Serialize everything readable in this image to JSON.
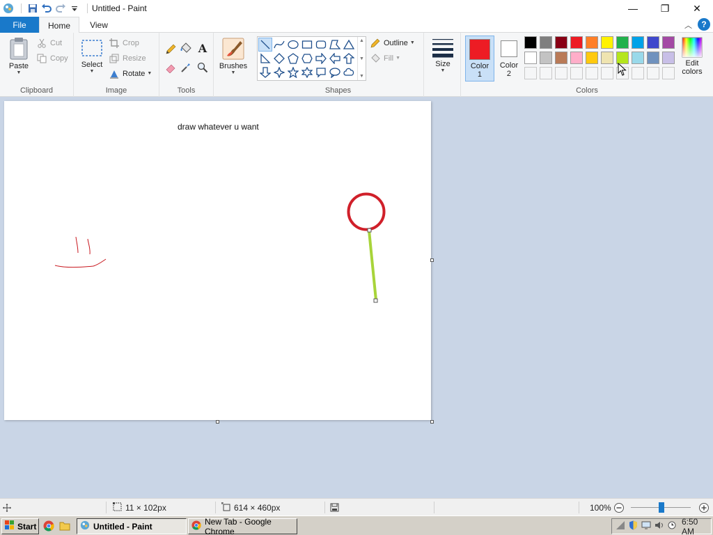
{
  "window": {
    "title": "Untitled - Paint"
  },
  "window_controls": {
    "minimize": "—",
    "maximize": "❐",
    "close": "✕"
  },
  "tabs": {
    "file": "File",
    "home": "Home",
    "view": "View"
  },
  "help": "?",
  "clipboard": {
    "group_label": "Clipboard",
    "paste": "Paste",
    "cut": "Cut",
    "copy": "Copy"
  },
  "image": {
    "group_label": "Image",
    "select": "Select",
    "crop": "Crop",
    "resize": "Resize",
    "rotate": "Rotate"
  },
  "tools": {
    "group_label": "Tools"
  },
  "brushes": {
    "label": "Brushes"
  },
  "shapes": {
    "group_label": "Shapes",
    "outline": "Outline",
    "fill": "Fill"
  },
  "size": {
    "label": "Size"
  },
  "colors": {
    "group_label": "Colors",
    "color1_label": "Color",
    "color1_num": "1",
    "color2_label": "Color",
    "color2_num": "2",
    "edit_label1": "Edit",
    "edit_label2": "colors",
    "color1": "#ed1c24",
    "color2": "#ffffff",
    "palette_row1": [
      "#000000",
      "#7f7f7f",
      "#880015",
      "#ed1c24",
      "#ff7f27",
      "#fff200",
      "#22b14c",
      "#00a2e8",
      "#3f48cc",
      "#a349a4"
    ],
    "palette_row2": [
      "#ffffff",
      "#c3c3c3",
      "#b97a57",
      "#ffaec9",
      "#ffc90e",
      "#efe4b0",
      "#b5e61d",
      "#99d9ea",
      "#7092be",
      "#c8bfe7"
    ]
  },
  "canvas": {
    "text": "draw whatever u want",
    "circle_color": "#d0202a",
    "line_color": "#a8d43a",
    "scribble_color": "#c8161d"
  },
  "status": {
    "selection_size": "11 × 102px",
    "canvas_size": "614 × 460px",
    "zoom": "100%"
  },
  "taskbar": {
    "start": "Start",
    "paint": "Untitled - Paint",
    "chrome": "New Tab - Google Chrome",
    "time": "6:50 AM"
  }
}
